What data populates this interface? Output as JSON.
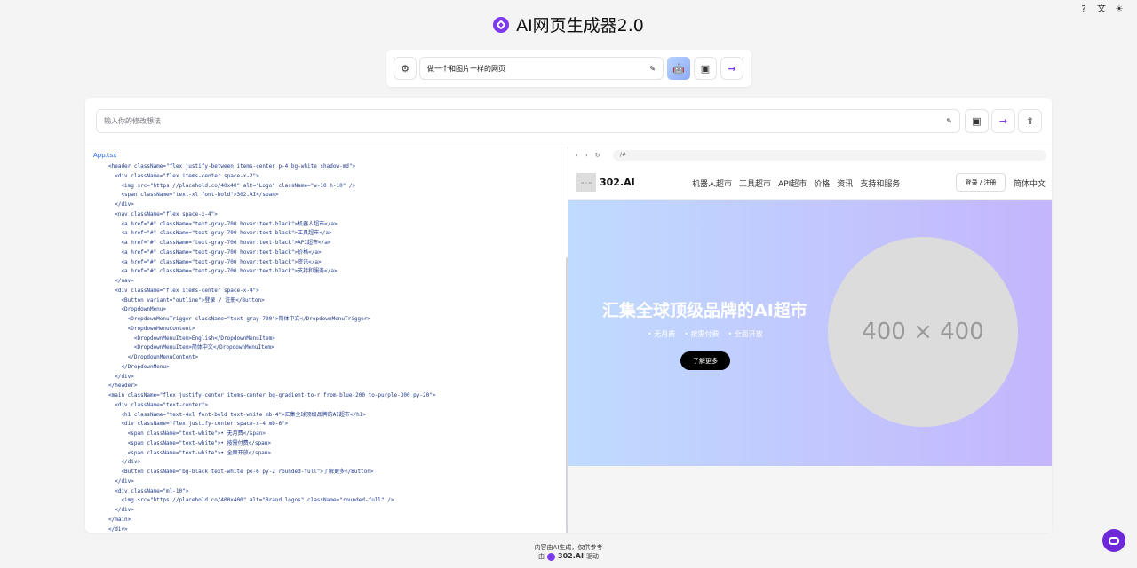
{
  "top_icons": [
    "help-icon",
    "translate-icon",
    "theme-icon"
  ],
  "header": {
    "title": "AI网页生成器2.0"
  },
  "prompt_bar": {
    "value": "做一个和图片一样的网页"
  },
  "modify_bar": {
    "placeholder": "输入你的修改想法"
  },
  "code_pane": {
    "file_tab": "App.tsx",
    "lines": [
      "<header className=\"flex justify-between items-center p-4 bg-white shadow-md\">",
      "  <div className=\"flex items-center space-x-2\">",
      "    <img src=\"https://placehold.co/40x40\" alt=\"Logo\" className=\"w-10 h-10\" />",
      "    <span className=\"text-xl font-bold\">302.AI</span>",
      "  </div>",
      "  <nav className=\"flex space-x-4\">",
      "    <a href=\"#\" className=\"text-gray-700 hover:text-black\">机器人超市</a>",
      "    <a href=\"#\" className=\"text-gray-700 hover:text-black\">工具超市</a>",
      "    <a href=\"#\" className=\"text-gray-700 hover:text-black\">API超市</a>",
      "    <a href=\"#\" className=\"text-gray-700 hover:text-black\">价格</a>",
      "    <a href=\"#\" className=\"text-gray-700 hover:text-black\">资讯</a>",
      "    <a href=\"#\" className=\"text-gray-700 hover:text-black\">支持和服务</a>",
      "  </nav>",
      "  <div className=\"flex items-center space-x-4\">",
      "    <Button variant=\"outline\">登录 / 注册</Button>",
      "    <DropdownMenu>",
      "      <DropdownMenuTrigger className=\"text-gray-700\">简体中文</DropdownMenuTrigger>",
      "      <DropdownMenuContent>",
      "        <DropdownMenuItem>English</DropdownMenuItem>",
      "        <DropdownMenuItem>简体中文</DropdownMenuItem>",
      "      </DropdownMenuContent>",
      "    </DropdownMenu>",
      "  </div>",
      "</header>",
      "<main className=\"flex justify-center items-center bg-gradient-to-r from-blue-200 to-purple-300 py-20\">",
      "  <div className=\"text-center\">",
      "    <h1 className=\"text-4xl font-bold text-white mb-4\">汇集全球顶级品牌的AI超市</h1>",
      "    <div className=\"flex justify-center space-x-4 mb-6\">",
      "      <span className=\"text-white\">• 无月费</span>",
      "      <span className=\"text-white\">• 按需付费</span>",
      "      <span className=\"text-white\">• 全面开放</span>",
      "    </div>",
      "    <Button className=\"bg-black text-white px-6 py-2 rounded-full\">了解更多</Button>",
      "  </div>",
      "  <div className=\"ml-10\">",
      "    <img src=\"https://placehold.co/400x400\" alt=\"Brand logos\" className=\"rounded-full\" />",
      "  </div>",
      "</main>",
      "</div>"
    ]
  },
  "preview": {
    "url": "/#",
    "site": {
      "logo_placeholder": "40 × 40",
      "brand": "302.AI",
      "nav_links": [
        "机器人超市",
        "工具超市",
        "API超市",
        "价格",
        "资讯",
        "支持和服务"
      ],
      "login": "登录 / 注册",
      "language": "简体中文",
      "hero_title": "汇集全球顶级品牌的AI超市",
      "features": [
        "• 无月费",
        "• 按需付费",
        "• 全面开放"
      ],
      "cta": "了解更多",
      "image_placeholder": "400 × 400"
    }
  },
  "footer": {
    "line1": "内容由AI生成，仅供参考",
    "prefix": "由",
    "brand": "302.AI",
    "suffix": "驱动"
  },
  "colors": {
    "accent": "#7c3aed",
    "hero_from": "#bfdbfe",
    "hero_to": "#c4b5fd"
  }
}
